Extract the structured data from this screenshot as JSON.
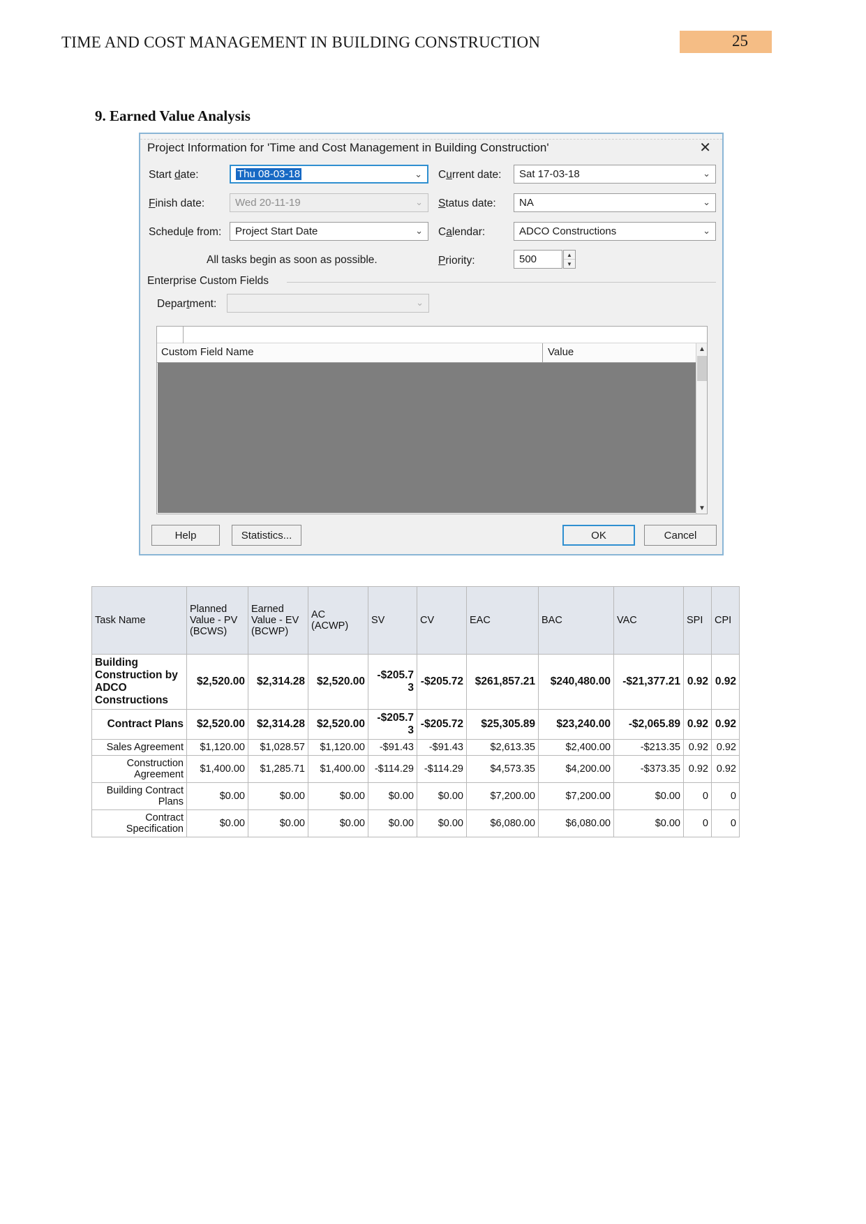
{
  "header": {
    "document_title": "TIME AND COST MANAGEMENT IN BUILDING CONSTRUCTION",
    "page_number": "25"
  },
  "section": {
    "heading": "9. Earned Value Analysis"
  },
  "dialog": {
    "title": "Project Information for 'Time and Cost Management in Building Construction'",
    "close_icon": "close-icon",
    "fields": {
      "start_date_label": "Start date:",
      "start_date_value": "Thu 08-03-18",
      "current_date_label": "Current date:",
      "current_date_value": "Sat 17-03-18",
      "finish_date_label": "Finish date:",
      "finish_date_value": "Wed 20-11-19",
      "status_date_label": "Status date:",
      "status_date_value": "NA",
      "schedule_from_label": "Schedule from:",
      "schedule_from_value": "Project Start Date",
      "calendar_label": "Calendar:",
      "calendar_value": "ADCO Constructions",
      "all_tasks_note": "All tasks begin as soon as possible.",
      "priority_label": "Priority:",
      "priority_value": "500",
      "enterprise_group_label": "Enterprise Custom Fields",
      "department_label": "Department:",
      "department_value": ""
    },
    "custom_field_grid": {
      "col_name": "Custom Field Name",
      "col_value": "Value"
    },
    "buttons": {
      "help": "Help",
      "statistics": "Statistics...",
      "ok": "OK",
      "cancel": "Cancel"
    }
  },
  "eva_table": {
    "columns": [
      "Task Name",
      "Planned Value - PV (BCWS)",
      "Earned Value - EV (BCWP)",
      "AC (ACWP)",
      "SV",
      "CV",
      "EAC",
      "BAC",
      "VAC",
      "SPI",
      "CPI"
    ],
    "rows": [
      {
        "task": "Building Construction by ADCO Constructions",
        "pv": "$2,520.00",
        "ev": "$2,314.28",
        "ac": "$2,520.00",
        "sv": "-$205.73",
        "cv": "-$205.72",
        "eac": "$261,857.21",
        "bac": "$240,480.00",
        "vac": "-$21,377.21",
        "spi": "0.92",
        "cpi": "0.92",
        "style": "bold",
        "indent": 0
      },
      {
        "task": "Contract Plans",
        "pv": "$2,520.00",
        "ev": "$2,314.28",
        "ac": "$2,520.00",
        "sv": "-$205.73",
        "cv": "-$205.72",
        "eac": "$25,305.89",
        "bac": "$23,240.00",
        "vac": "-$2,065.89",
        "spi": "0.92",
        "cpi": "0.92",
        "style": "bold",
        "indent": 1
      },
      {
        "task": "Sales Agreement",
        "pv": "$1,120.00",
        "ev": "$1,028.57",
        "ac": "$1,120.00",
        "sv": "-$91.43",
        "cv": "-$91.43",
        "eac": "$2,613.35",
        "bac": "$2,400.00",
        "vac": "-$213.35",
        "spi": "0.92",
        "cpi": "0.92",
        "style": "normal",
        "indent": 2
      },
      {
        "task": "Construction Agreement",
        "pv": "$1,400.00",
        "ev": "$1,285.71",
        "ac": "$1,400.00",
        "sv": "-$114.29",
        "cv": "-$114.29",
        "eac": "$4,573.35",
        "bac": "$4,200.00",
        "vac": "-$373.35",
        "spi": "0.92",
        "cpi": "0.92",
        "style": "normal",
        "indent": 2
      },
      {
        "task": "Building Contract Plans",
        "pv": "$0.00",
        "ev": "$0.00",
        "ac": "$0.00",
        "sv": "$0.00",
        "cv": "$0.00",
        "eac": "$7,200.00",
        "bac": "$7,200.00",
        "vac": "$0.00",
        "spi": "0",
        "cpi": "0",
        "style": "normal",
        "indent": 2
      },
      {
        "task": "Contract Specification",
        "pv": "$0.00",
        "ev": "$0.00",
        "ac": "$0.00",
        "sv": "$0.00",
        "cv": "$0.00",
        "eac": "$6,080.00",
        "bac": "$6,080.00",
        "vac": "$0.00",
        "spi": "0",
        "cpi": "0",
        "style": "normal",
        "indent": 2
      }
    ]
  },
  "colors": {
    "page_badge": "#f5bd85",
    "table_header": "#e2e6ed",
    "accent_focus": "#2f8fd0",
    "selection": "#1769c4"
  }
}
